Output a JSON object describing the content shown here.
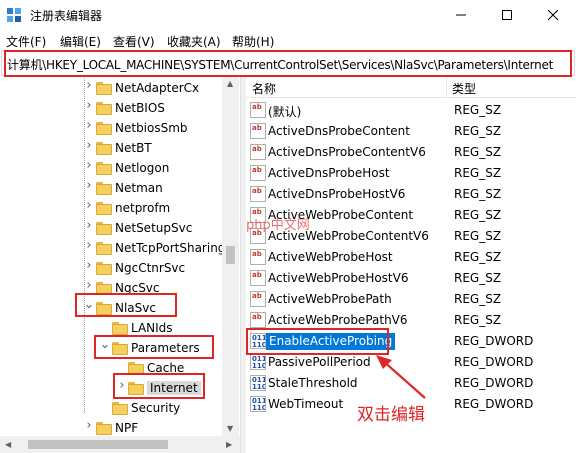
{
  "window": {
    "title": "注册表编辑器",
    "icon": "regedit-icon"
  },
  "menu": [
    "文件(F)",
    "编辑(E)",
    "查看(V)",
    "收藏夹(A)",
    "帮助(H)"
  ],
  "address": "计算机\\HKEY_LOCAL_MACHINE\\SYSTEM\\CurrentControlSet\\Services\\NlaSvc\\Parameters\\Internet",
  "tree": [
    {
      "label": "NetAdapterCx",
      "depth": 0
    },
    {
      "label": "NetBIOS",
      "depth": 0
    },
    {
      "label": "NetbiosSmb",
      "depth": 0
    },
    {
      "label": "NetBT",
      "depth": 0
    },
    {
      "label": "Netlogon",
      "depth": 0
    },
    {
      "label": "Netman",
      "depth": 0
    },
    {
      "label": "netprofm",
      "depth": 0
    },
    {
      "label": "NetSetupSvc",
      "depth": 0
    },
    {
      "label": "NetTcpPortSharing",
      "depth": 0
    },
    {
      "label": "NgcCtnrSvc",
      "depth": 0
    },
    {
      "label": "NgcSvc",
      "depth": 0
    },
    {
      "label": "NlaSvc",
      "depth": 0,
      "expanded": true
    },
    {
      "label": "LANIds",
      "depth": 1
    },
    {
      "label": "Parameters",
      "depth": 1,
      "expanded": true
    },
    {
      "label": "Cache",
      "depth": 2
    },
    {
      "label": "Internet",
      "depth": 2,
      "selected": true
    },
    {
      "label": "Security",
      "depth": 1
    },
    {
      "label": "NPF",
      "depth": 0
    }
  ],
  "list": {
    "col_name": "名称",
    "col_type": "类型",
    "rows": [
      {
        "name": "(默认)",
        "type": "REG_SZ",
        "kind": "sz"
      },
      {
        "name": "ActiveDnsProbeContent",
        "type": "REG_SZ",
        "kind": "sz"
      },
      {
        "name": "ActiveDnsProbeContentV6",
        "type": "REG_SZ",
        "kind": "sz"
      },
      {
        "name": "ActiveDnsProbeHost",
        "type": "REG_SZ",
        "kind": "sz"
      },
      {
        "name": "ActiveDnsProbeHostV6",
        "type": "REG_SZ",
        "kind": "sz"
      },
      {
        "name": "ActiveWebProbeContent",
        "type": "REG_SZ",
        "kind": "sz"
      },
      {
        "name": "ActiveWebProbeContentV6",
        "type": "REG_SZ",
        "kind": "sz"
      },
      {
        "name": "ActiveWebProbeHost",
        "type": "REG_SZ",
        "kind": "sz"
      },
      {
        "name": "ActiveWebProbeHostV6",
        "type": "REG_SZ",
        "kind": "sz"
      },
      {
        "name": "ActiveWebProbePath",
        "type": "REG_SZ",
        "kind": "sz"
      },
      {
        "name": "ActiveWebProbePathV6",
        "type": "REG_SZ",
        "kind": "sz"
      },
      {
        "name": "EnableActiveProbing",
        "type": "REG_DWORD",
        "kind": "dw",
        "selected": true
      },
      {
        "name": "PassivePollPeriod",
        "type": "REG_DWORD",
        "kind": "dw"
      },
      {
        "name": "StaleThreshold",
        "type": "REG_DWORD",
        "kind": "dw"
      },
      {
        "name": "WebTimeout",
        "type": "REG_DWORD",
        "kind": "dw"
      }
    ]
  },
  "annotation": {
    "text": "双击编辑",
    "color": "#e02525"
  },
  "watermark": "php中文网",
  "colors": {
    "selection": "#0078d7",
    "folder": "#f7cf5c",
    "annotation": "#e02525"
  }
}
